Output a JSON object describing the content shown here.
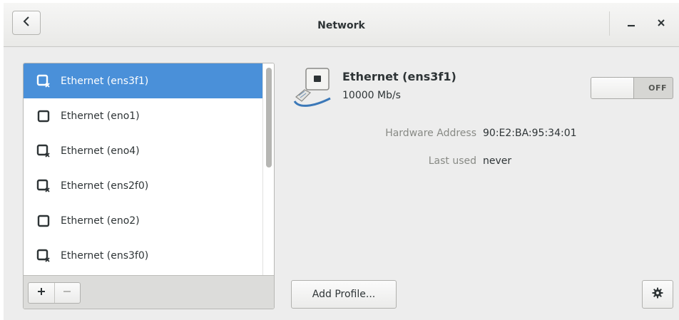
{
  "window": {
    "title": "Network"
  },
  "icons": {
    "back": "chevron-left-icon",
    "minimize": "minimize-icon",
    "close": "close-icon",
    "add": "plus-icon",
    "remove": "minus-icon",
    "settings": "gear-icon",
    "device_connected": "ethernet-icon",
    "device_disconnected": "ethernet-disconnected-icon",
    "device_large": "network-card-icon"
  },
  "colors": {
    "selection": "#4a90d9",
    "secondary_text": "#888a85"
  },
  "device_list": [
    {
      "label": "Ethernet (ens3f1)",
      "icon": "ethernet-disconnected-icon",
      "selected": true
    },
    {
      "label": "Ethernet (eno1)",
      "icon": "ethernet-icon",
      "selected": false
    },
    {
      "label": "Ethernet (eno4)",
      "icon": "ethernet-disconnected-icon",
      "selected": false
    },
    {
      "label": "Ethernet (ens2f0)",
      "icon": "ethernet-disconnected-icon",
      "selected": false
    },
    {
      "label": "Ethernet (eno2)",
      "icon": "ethernet-icon",
      "selected": false
    },
    {
      "label": "Ethernet (ens3f0)",
      "icon": "ethernet-disconnected-icon",
      "selected": false
    }
  ],
  "toolbar": {
    "add_label": "+",
    "remove_label": "−"
  },
  "details": {
    "name": "Ethernet (ens3f1)",
    "speed": "10000 Mb/s",
    "switch_label": "OFF",
    "switch_on": false,
    "hardware_address_label": "Hardware Address",
    "hardware_address": "90:E2:BA:95:34:01",
    "last_used_label": "Last used",
    "last_used": "never",
    "add_profile_label": "Add Profile..."
  }
}
